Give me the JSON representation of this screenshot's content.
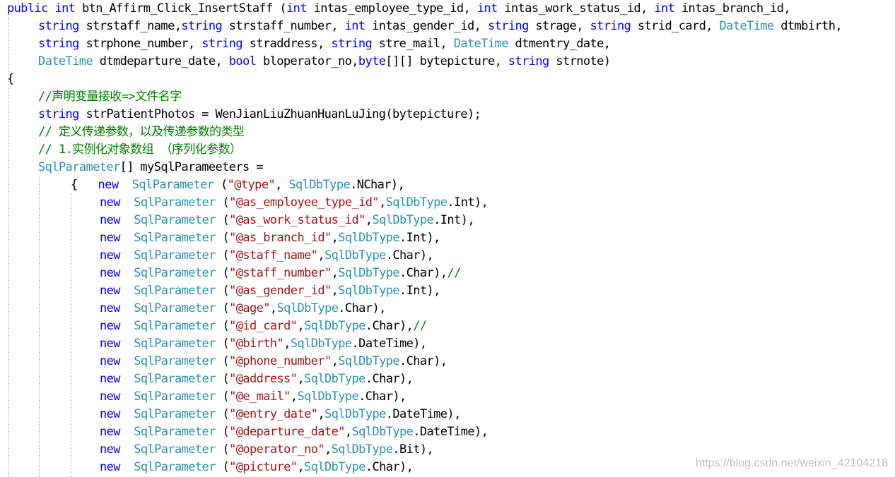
{
  "code": {
    "lines": [
      {
        "indent": 0,
        "tokens": [
          [
            "k",
            "public"
          ],
          [
            "p",
            " "
          ],
          [
            "k",
            "int"
          ],
          [
            "p",
            " btn_Affirm_Click_InsertStaff ("
          ],
          [
            "k",
            "int"
          ],
          [
            "p",
            " intas_employee_type_id, "
          ],
          [
            "k",
            "int"
          ],
          [
            "p",
            " intas_work_status_id, "
          ],
          [
            "k",
            "int"
          ],
          [
            "p",
            " intas_branch_id,"
          ]
        ]
      },
      {
        "indent": 1,
        "tokens": [
          [
            "k",
            "string"
          ],
          [
            "p",
            " strstaff_name,"
          ],
          [
            "k",
            "string"
          ],
          [
            "p",
            " strstaff_number, "
          ],
          [
            "k",
            "int"
          ],
          [
            "p",
            " intas_gender_id, "
          ],
          [
            "k",
            "string"
          ],
          [
            "p",
            " strage, "
          ],
          [
            "k",
            "string"
          ],
          [
            "p",
            " strid_card, "
          ],
          [
            "t",
            "DateTime"
          ],
          [
            "p",
            " dtmbirth,"
          ]
        ]
      },
      {
        "indent": 1,
        "tokens": [
          [
            "k",
            "string"
          ],
          [
            "p",
            " strphone_number, "
          ],
          [
            "k",
            "string"
          ],
          [
            "p",
            " straddress, "
          ],
          [
            "k",
            "string"
          ],
          [
            "p",
            " stre_mail, "
          ],
          [
            "t",
            "DateTime"
          ],
          [
            "p",
            " dtmentry_date,"
          ]
        ]
      },
      {
        "indent": 1,
        "tokens": [
          [
            "t",
            "DateTime"
          ],
          [
            "p",
            " dtmdeparture_date, "
          ],
          [
            "k",
            "bool"
          ],
          [
            "p",
            " bloperator_no,"
          ],
          [
            "k",
            "byte"
          ],
          [
            "p",
            "[][] bytepicture, "
          ],
          [
            "k",
            "string"
          ],
          [
            "p",
            " strnote)"
          ]
        ]
      },
      {
        "indent": 0,
        "tokens": [
          [
            "p",
            "{"
          ]
        ]
      },
      {
        "indent": 1,
        "tokens": [
          [
            "c",
            "//声明变量接收=>文件名字"
          ]
        ]
      },
      {
        "indent": 1,
        "tokens": [
          [
            "k",
            "string"
          ],
          [
            "p",
            " strPatientPhotos = WenJianLiuZhuanHuanLuJing(bytepicture);"
          ]
        ]
      },
      {
        "indent": 1,
        "tokens": [
          [
            "c",
            "// 定义传递参数，以及传递参数的类型"
          ]
        ]
      },
      {
        "indent": 1,
        "tokens": [
          [
            "c",
            "// 1.实例化对象数组 （序列化参数）"
          ]
        ]
      },
      {
        "indent": 1,
        "tokens": [
          [
            "t",
            "SqlParameter"
          ],
          [
            "p",
            "[] mySqlParameeters ="
          ]
        ]
      },
      {
        "indent": 2,
        "tokens": [
          [
            "p",
            "{   "
          ],
          [
            "k",
            "new"
          ],
          [
            "p",
            "  "
          ],
          [
            "t",
            "SqlParameter"
          ],
          [
            "p",
            " ("
          ],
          [
            "s",
            "\"@type\""
          ],
          [
            "p",
            ", "
          ],
          [
            "t",
            "SqlDbType"
          ],
          [
            "p",
            ".NChar),"
          ]
        ]
      },
      {
        "indent": 3,
        "tokens": [
          [
            "k",
            "new"
          ],
          [
            "p",
            "  "
          ],
          [
            "t",
            "SqlParameter"
          ],
          [
            "p",
            " ("
          ],
          [
            "s",
            "\"@as_employee_type_id\""
          ],
          [
            "p",
            ","
          ],
          [
            "t",
            "SqlDbType"
          ],
          [
            "p",
            ".Int),"
          ]
        ]
      },
      {
        "indent": 3,
        "tokens": [
          [
            "k",
            "new"
          ],
          [
            "p",
            "  "
          ],
          [
            "t",
            "SqlParameter"
          ],
          [
            "p",
            " ("
          ],
          [
            "s",
            "\"@as_work_status_id\""
          ],
          [
            "p",
            ","
          ],
          [
            "t",
            "SqlDbType"
          ],
          [
            "p",
            ".Int),"
          ]
        ]
      },
      {
        "indent": 3,
        "tokens": [
          [
            "k",
            "new"
          ],
          [
            "p",
            "  "
          ],
          [
            "t",
            "SqlParameter"
          ],
          [
            "p",
            " ("
          ],
          [
            "s",
            "\"@as_branch_id\""
          ],
          [
            "p",
            ","
          ],
          [
            "t",
            "SqlDbType"
          ],
          [
            "p",
            ".Int),"
          ]
        ]
      },
      {
        "indent": 3,
        "tokens": [
          [
            "k",
            "new"
          ],
          [
            "p",
            "  "
          ],
          [
            "t",
            "SqlParameter"
          ],
          [
            "p",
            " ("
          ],
          [
            "s",
            "\"@staff_name\""
          ],
          [
            "p",
            ","
          ],
          [
            "t",
            "SqlDbType"
          ],
          [
            "p",
            ".Char),"
          ]
        ]
      },
      {
        "indent": 3,
        "tokens": [
          [
            "k",
            "new"
          ],
          [
            "p",
            "  "
          ],
          [
            "t",
            "SqlParameter"
          ],
          [
            "p",
            " ("
          ],
          [
            "s",
            "\"@staff_number\""
          ],
          [
            "p",
            ","
          ],
          [
            "t",
            "SqlDbType"
          ],
          [
            "p",
            ".Char),"
          ],
          [
            "c",
            "//"
          ]
        ]
      },
      {
        "indent": 3,
        "tokens": [
          [
            "k",
            "new"
          ],
          [
            "p",
            "  "
          ],
          [
            "t",
            "SqlParameter"
          ],
          [
            "p",
            " ("
          ],
          [
            "s",
            "\"@as_gender_id\""
          ],
          [
            "p",
            ","
          ],
          [
            "t",
            "SqlDbType"
          ],
          [
            "p",
            ".Int),"
          ]
        ]
      },
      {
        "indent": 3,
        "tokens": [
          [
            "k",
            "new"
          ],
          [
            "p",
            "  "
          ],
          [
            "t",
            "SqlParameter"
          ],
          [
            "p",
            " ("
          ],
          [
            "s",
            "\"@age\""
          ],
          [
            "p",
            ","
          ],
          [
            "t",
            "SqlDbType"
          ],
          [
            "p",
            ".Char),"
          ]
        ]
      },
      {
        "indent": 3,
        "tokens": [
          [
            "k",
            "new"
          ],
          [
            "p",
            "  "
          ],
          [
            "t",
            "SqlParameter"
          ],
          [
            "p",
            " ("
          ],
          [
            "s",
            "\"@id_card\""
          ],
          [
            "p",
            ","
          ],
          [
            "t",
            "SqlDbType"
          ],
          [
            "p",
            ".Char),"
          ],
          [
            "c",
            "//"
          ]
        ]
      },
      {
        "indent": 3,
        "tokens": [
          [
            "k",
            "new"
          ],
          [
            "p",
            "  "
          ],
          [
            "t",
            "SqlParameter"
          ],
          [
            "p",
            " ("
          ],
          [
            "s",
            "\"@birth\""
          ],
          [
            "p",
            ","
          ],
          [
            "t",
            "SqlDbType"
          ],
          [
            "p",
            ".DateTime),"
          ]
        ]
      },
      {
        "indent": 3,
        "tokens": [
          [
            "k",
            "new"
          ],
          [
            "p",
            "  "
          ],
          [
            "t",
            "SqlParameter"
          ],
          [
            "p",
            " ("
          ],
          [
            "s",
            "\"@phone_number\""
          ],
          [
            "p",
            ","
          ],
          [
            "t",
            "SqlDbType"
          ],
          [
            "p",
            ".Char),"
          ]
        ]
      },
      {
        "indent": 3,
        "tokens": [
          [
            "k",
            "new"
          ],
          [
            "p",
            "  "
          ],
          [
            "t",
            "SqlParameter"
          ],
          [
            "p",
            " ("
          ],
          [
            "s",
            "\"@address\""
          ],
          [
            "p",
            ","
          ],
          [
            "t",
            "SqlDbType"
          ],
          [
            "p",
            ".Char),"
          ]
        ]
      },
      {
        "indent": 3,
        "tokens": [
          [
            "k",
            "new"
          ],
          [
            "p",
            "  "
          ],
          [
            "t",
            "SqlParameter"
          ],
          [
            "p",
            " ("
          ],
          [
            "s",
            "\"@e_mail\""
          ],
          [
            "p",
            ","
          ],
          [
            "t",
            "SqlDbType"
          ],
          [
            "p",
            ".Char),"
          ]
        ]
      },
      {
        "indent": 3,
        "tokens": [
          [
            "k",
            "new"
          ],
          [
            "p",
            "  "
          ],
          [
            "t",
            "SqlParameter"
          ],
          [
            "p",
            " ("
          ],
          [
            "s",
            "\"@entry_date\""
          ],
          [
            "p",
            ","
          ],
          [
            "t",
            "SqlDbType"
          ],
          [
            "p",
            ".DateTime),"
          ]
        ]
      },
      {
        "indent": 3,
        "tokens": [
          [
            "k",
            "new"
          ],
          [
            "p",
            "  "
          ],
          [
            "t",
            "SqlParameter"
          ],
          [
            "p",
            " ("
          ],
          [
            "s",
            "\"@departure_date\""
          ],
          [
            "p",
            ","
          ],
          [
            "t",
            "SqlDbType"
          ],
          [
            "p",
            ".DateTime),"
          ]
        ]
      },
      {
        "indent": 3,
        "tokens": [
          [
            "k",
            "new"
          ],
          [
            "p",
            "  "
          ],
          [
            "t",
            "SqlParameter"
          ],
          [
            "p",
            " ("
          ],
          [
            "s",
            "\"@operator_no\""
          ],
          [
            "p",
            ","
          ],
          [
            "t",
            "SqlDbType"
          ],
          [
            "p",
            ".Bit),"
          ]
        ]
      },
      {
        "indent": 3,
        "tokens": [
          [
            "k",
            "new"
          ],
          [
            "p",
            "  "
          ],
          [
            "t",
            "SqlParameter"
          ],
          [
            "p",
            " ("
          ],
          [
            "s",
            "\"@picture\""
          ],
          [
            "p",
            ","
          ],
          [
            "t",
            "SqlDbType"
          ],
          [
            "p",
            ".Char),"
          ]
        ]
      }
    ]
  },
  "watermark": "https://blog.csdn.net/weixin_42104218",
  "colors": {
    "keyword": "#0000ff",
    "type": "#2b91af",
    "string": "#a31515",
    "comment": "#008000",
    "plain": "#000000",
    "background": "#ffffff"
  }
}
